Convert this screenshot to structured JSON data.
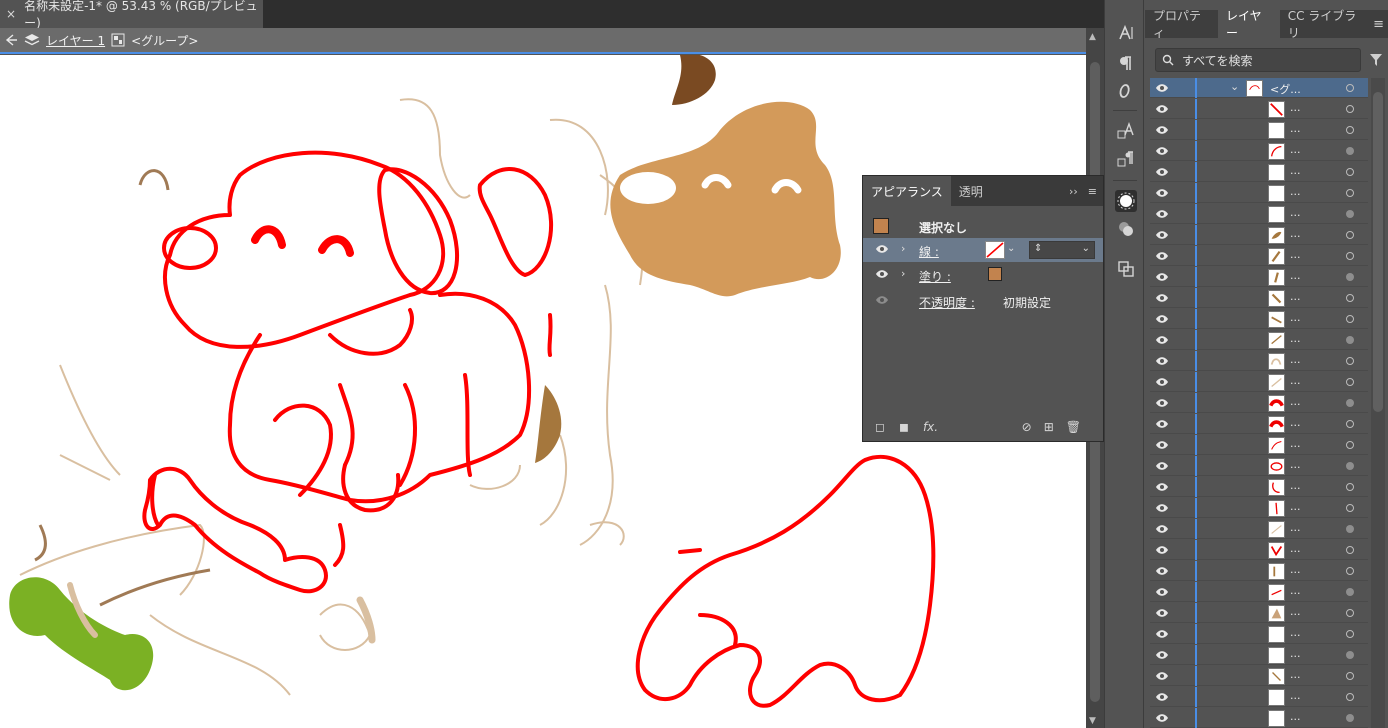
{
  "document": {
    "tab_title": "名称未設定-1* @ 53.43 % (RGB/プレビュー)",
    "close_glyph": "×"
  },
  "breadcrumb": {
    "layer": "レイヤー 1",
    "group": "<グループ>"
  },
  "right_panel": {
    "tabs": [
      "プロパティ",
      "レイヤー",
      "CC ライブラリ"
    ],
    "active_tab": "レイヤー",
    "search_placeholder": "すべてを検索",
    "group_row_name": "<グ...",
    "item_label": "...",
    "row_count": 31
  },
  "appearance": {
    "tabs": [
      "アピアランス",
      "透明"
    ],
    "selection_label": "選択なし",
    "stroke_label": "線 :",
    "fill_label": "塗り :",
    "opacity_label": "不透明度 :",
    "opacity_value": "初期設定",
    "fx_label": "fx."
  },
  "colors": {
    "accent": "#4a8ee6",
    "fill_swatch": "#c2834e",
    "outline": "#ff0000",
    "head_fill": "#d39a5a",
    "bone": "#7bb124",
    "sketch": "#d9bfa0"
  }
}
